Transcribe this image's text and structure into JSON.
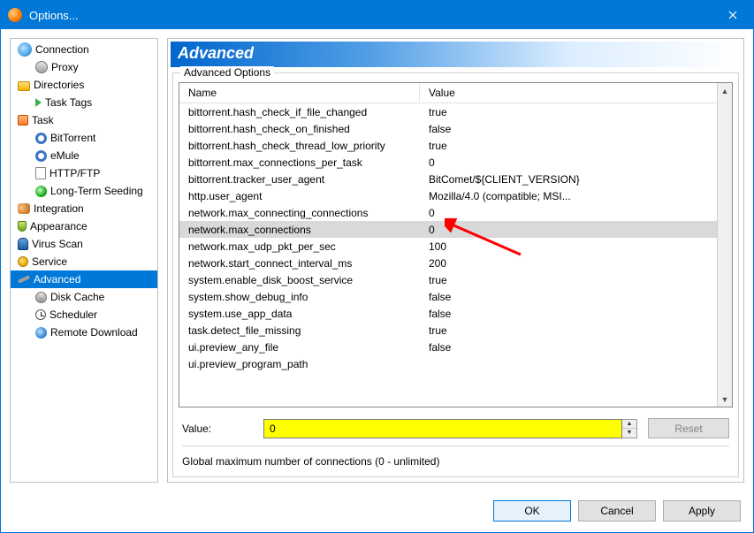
{
  "window": {
    "title": "Options..."
  },
  "tree": [
    {
      "label": "Connection",
      "lvl": 1,
      "icon": "ico-globe"
    },
    {
      "label": "Proxy",
      "lvl": 2,
      "icon": "ico-proxy"
    },
    {
      "label": "Directories",
      "lvl": 1,
      "icon": "ico-folder"
    },
    {
      "label": "Task Tags",
      "lvl": 2,
      "icon": "ico-tag"
    },
    {
      "label": "Task",
      "lvl": 1,
      "icon": "ico-task"
    },
    {
      "label": "BitTorrent",
      "lvl": 2,
      "icon": "ico-gear"
    },
    {
      "label": "eMule",
      "lvl": 2,
      "icon": "ico-gear"
    },
    {
      "label": "HTTP/FTP",
      "lvl": 2,
      "icon": "ico-page"
    },
    {
      "label": "Long-Term Seeding",
      "lvl": 2,
      "icon": "ico-seed"
    },
    {
      "label": "Integration",
      "lvl": 1,
      "icon": "ico-users"
    },
    {
      "label": "Appearance",
      "lvl": 1,
      "icon": "ico-appear"
    },
    {
      "label": "Virus Scan",
      "lvl": 1,
      "icon": "ico-virus"
    },
    {
      "label": "Service",
      "lvl": 1,
      "icon": "ico-service"
    },
    {
      "label": "Advanced",
      "lvl": 1,
      "icon": "ico-wrench",
      "selected": true
    },
    {
      "label": "Disk Cache",
      "lvl": 2,
      "icon": "ico-disk"
    },
    {
      "label": "Scheduler",
      "lvl": 2,
      "icon": "ico-sched"
    },
    {
      "label": "Remote Download",
      "lvl": 2,
      "icon": "ico-remote"
    }
  ],
  "panel": {
    "title": "Advanced",
    "group_label": "Advanced Options",
    "headers": {
      "name": "Name",
      "value": "Value"
    },
    "rows": [
      {
        "name": "bittorrent.hash_check_if_file_changed",
        "value": "true"
      },
      {
        "name": "bittorrent.hash_check_on_finished",
        "value": "false"
      },
      {
        "name": "bittorrent.hash_check_thread_low_priority",
        "value": "true"
      },
      {
        "name": "bittorrent.max_connections_per_task",
        "value": "0"
      },
      {
        "name": "bittorrent.tracker_user_agent",
        "value": "BitComet/${CLIENT_VERSION}"
      },
      {
        "name": "http.user_agent",
        "value": "Mozilla/4.0 (compatible; MSI..."
      },
      {
        "name": "network.max_connecting_connections",
        "value": "0"
      },
      {
        "name": "network.max_connections",
        "value": "0",
        "selected": true
      },
      {
        "name": "network.max_udp_pkt_per_sec",
        "value": "100"
      },
      {
        "name": "network.start_connect_interval_ms",
        "value": "200"
      },
      {
        "name": "system.enable_disk_boost_service",
        "value": "true"
      },
      {
        "name": "system.show_debug_info",
        "value": "false"
      },
      {
        "name": "system.use_app_data",
        "value": "false"
      },
      {
        "name": "task.detect_file_missing",
        "value": "true"
      },
      {
        "name": "ui.preview_any_file",
        "value": "false"
      },
      {
        "name": "ui.preview_program_path",
        "value": ""
      }
    ],
    "selected_index": 7,
    "value_label": "Value:",
    "value_input": "0",
    "reset_label": "Reset",
    "description": "Global maximum number of connections (0 - unlimited)"
  },
  "buttons": {
    "ok": "OK",
    "cancel": "Cancel",
    "apply": "Apply"
  }
}
